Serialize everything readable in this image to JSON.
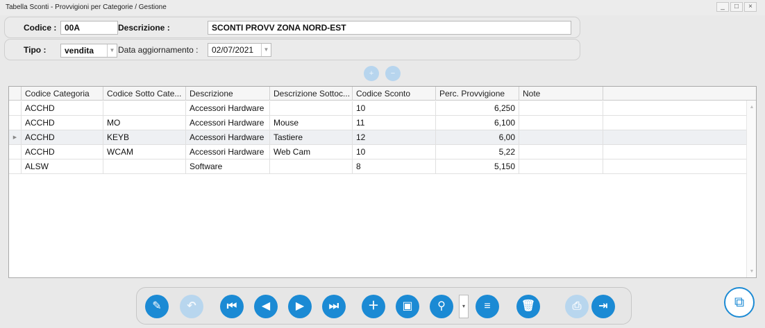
{
  "window": {
    "title": "Tabella Sconti - Provvigioni per Categorie / Gestione",
    "controls": [
      "_",
      "□",
      "×"
    ]
  },
  "form": {
    "codice_label": "Codice :",
    "codice_value": "00A",
    "descrizione_label": "Descrizione :",
    "descrizione_value": "SCONTI PROVV ZONA NORD-EST",
    "tipo_label": "Tipo :",
    "tipo_value": "vendita",
    "data_label": "Data aggiornamento :",
    "data_value": "02/07/2021"
  },
  "grid": {
    "columns": [
      "Codice Categoria",
      "Codice Sotto Cate...",
      "Descrizione",
      "Descrizione Sottoc...",
      "Codice Sconto",
      "Perc. Provvigione",
      "Note"
    ],
    "rows": [
      {
        "cod_cat": "ACCHD",
        "cod_sotto": "",
        "descr": "Accessori Hardware",
        "descr_sotto": "",
        "cod_sconto": "10",
        "perc": "6,250",
        "note": ""
      },
      {
        "cod_cat": "ACCHD",
        "cod_sotto": "MO",
        "descr": "Accessori Hardware",
        "descr_sotto": "Mouse",
        "cod_sconto": "11",
        "perc": "6,100",
        "note": ""
      },
      {
        "cod_cat": "ACCHD",
        "cod_sotto": "KEYB",
        "descr": "Accessori Hardware",
        "descr_sotto": "Tastiere",
        "cod_sconto": "12",
        "perc": "6,00",
        "note": ""
      },
      {
        "cod_cat": "ACCHD",
        "cod_sotto": "WCAM",
        "descr": "Accessori Hardware",
        "descr_sotto": "Web Cam",
        "cod_sconto": "10",
        "perc": "5,22",
        "note": ""
      },
      {
        "cod_cat": "ALSW",
        "cod_sotto": "",
        "descr": "Software",
        "descr_sotto": "",
        "cod_sconto": "8",
        "perc": "5,150",
        "note": ""
      }
    ],
    "selected_row": 2
  },
  "toolbar": {
    "buttons": [
      {
        "name": "edit-document-button",
        "icon": "✎",
        "enabled": true
      },
      {
        "name": "undo-button",
        "icon": "↶",
        "enabled": false
      },
      {
        "name": "first-record-button",
        "icon": "⏮",
        "enabled": true
      },
      {
        "name": "previous-record-button",
        "icon": "◀",
        "enabled": true
      },
      {
        "name": "next-record-button",
        "icon": "▶",
        "enabled": true
      },
      {
        "name": "last-record-button",
        "icon": "⏭",
        "enabled": true
      },
      {
        "name": "new-document-button",
        "icon": "＋",
        "enabled": true
      },
      {
        "name": "save-button",
        "icon": "▣",
        "enabled": true
      },
      {
        "name": "search-button",
        "icon": "⚲",
        "enabled": true
      },
      {
        "name": "list-button",
        "icon": "≡",
        "enabled": true
      },
      {
        "name": "delete-button",
        "icon": "🗑",
        "enabled": true
      },
      {
        "name": "print-button",
        "icon": "⎙",
        "enabled": false
      },
      {
        "name": "exit-button",
        "icon": "⇥",
        "enabled": true
      }
    ],
    "search_dropdown": "▾",
    "corner": "⧉"
  },
  "mini": {
    "add_row": "+",
    "remove_row": "−"
  },
  "colors": {
    "accent": "#1b8ad4",
    "accent_disabled": "#b8d6ee"
  }
}
